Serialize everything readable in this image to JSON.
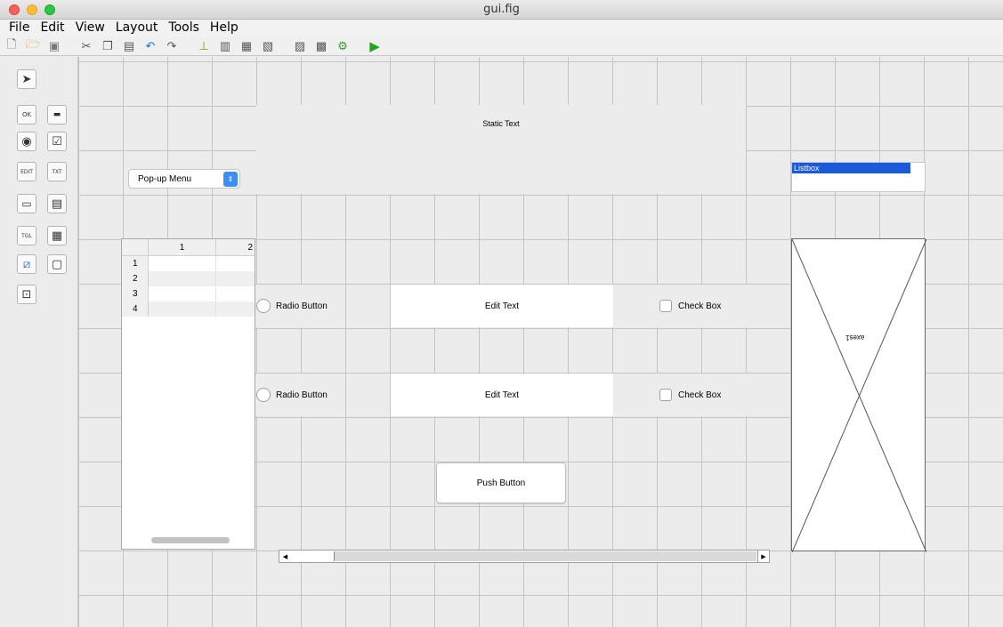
{
  "window": {
    "title": "gui.fig"
  },
  "menu": [
    "File",
    "Edit",
    "View",
    "Layout",
    "Tools",
    "Help"
  ],
  "toolbar_icons": [
    "new-icon",
    "open-icon",
    "save-icon",
    "cut-icon",
    "copy-icon",
    "paste-icon",
    "undo-icon",
    "redo-icon",
    "align-icon",
    "menu-editor-icon",
    "tab-order-icon",
    "toolbar-editor-icon",
    "editor-icon",
    "property-inspector-icon",
    "object-browser-icon",
    "run-icon"
  ],
  "palette": [
    {
      "name": "select-tool",
      "glyph": "➤"
    },
    {
      "name": "push-button-tool",
      "glyph": "OK"
    },
    {
      "name": "slider-tool",
      "glyph": "▬"
    },
    {
      "name": "radio-button-tool",
      "glyph": "◉"
    },
    {
      "name": "check-box-tool",
      "glyph": "☑"
    },
    {
      "name": "edit-text-tool",
      "glyph": "EDIT"
    },
    {
      "name": "static-text-tool",
      "glyph": "TXT"
    },
    {
      "name": "popup-menu-tool",
      "glyph": "▭"
    },
    {
      "name": "listbox-tool",
      "glyph": "▤"
    },
    {
      "name": "toggle-button-tool",
      "glyph": "TGL"
    },
    {
      "name": "table-tool",
      "glyph": "▦"
    },
    {
      "name": "axes-tool",
      "glyph": "⧄"
    },
    {
      "name": "panel-tool",
      "glyph": "▢"
    },
    {
      "name": "button-group-tool",
      "glyph": "⊡"
    }
  ],
  "components": {
    "static_text": "Static Text",
    "popup_menu": "Pop-up Menu",
    "listbox_item": "Listbox",
    "table": {
      "columns": [
        "1",
        "2"
      ],
      "rows": [
        "1",
        "2",
        "3",
        "4"
      ]
    },
    "radio_button_1": "Radio Button",
    "radio_button_2": "Radio Button",
    "edit_text_1": "Edit Text",
    "edit_text_2": "Edit Text",
    "check_box_1": "Check Box",
    "check_box_2": "Check Box",
    "push_button": "Push Button",
    "axes_label": "axes1"
  },
  "colors": {
    "listbox_selection": "#1a5adb",
    "popup_arrow": "#3a8ef6",
    "run_icon": "#1fa51f"
  }
}
